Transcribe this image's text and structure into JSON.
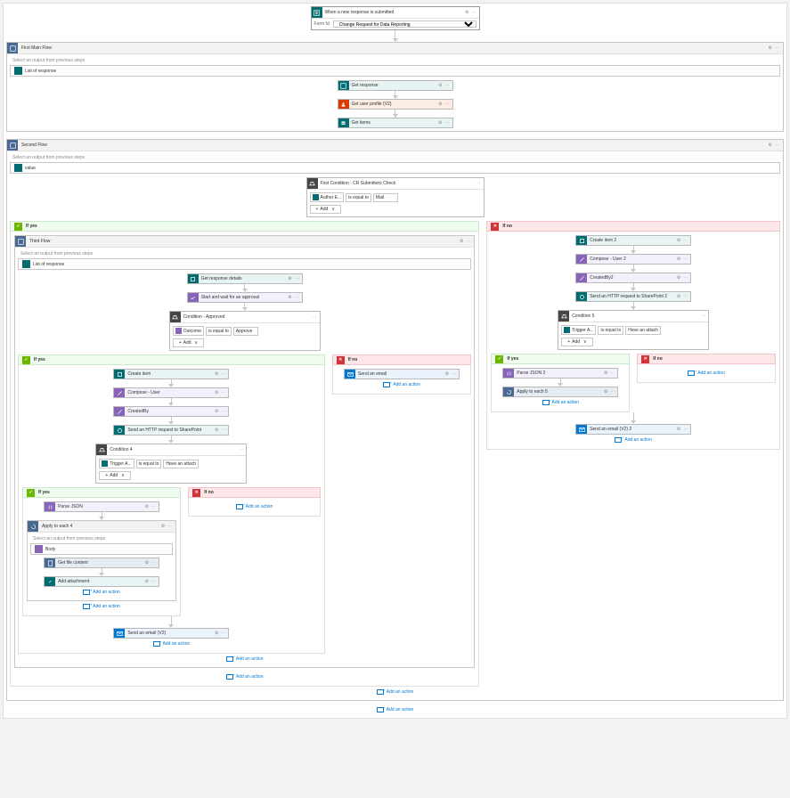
{
  "trigger": {
    "title": "When a new response is submitted",
    "param_label": "Form Id",
    "param_value": "Change Request for Data Reporting"
  },
  "labels": {
    "yes": "If yes",
    "no": "If no",
    "add_action": "Add an action",
    "add": "Add"
  },
  "scope1": {
    "title": "First Main Flow",
    "note": "Select an output from previous steps",
    "token": "List of response",
    "items": [
      "Get response",
      "Get user profile (V2)",
      "Get items"
    ]
  },
  "scope2": {
    "title": "Second Flow",
    "note": "Select an output from previous steps",
    "token": "value"
  },
  "cond1": {
    "title": "First Condition - CR Submitters Check",
    "lhs": "Author E...",
    "op": "is equal to",
    "rhs": "Mail"
  },
  "yes1_scope": {
    "title": "Third Flow",
    "note": "Select an output from previous steps",
    "token": "List of response",
    "items": [
      "Get response details",
      "Start and wait for an approval"
    ]
  },
  "cond2": {
    "title": "Condition - Approved",
    "lhs": "Outcome",
    "op": "is equal to",
    "rhs": "Approve"
  },
  "yes2_items": [
    "Create item",
    "Compose - User",
    "CreatedBy",
    "Send an HTTP request to SharePoint"
  ],
  "cond3": {
    "title": "Condition 4",
    "lhs": "Trigger A...",
    "op": "is equal to",
    "rhs": "Have an attach"
  },
  "yes3_parse": "Parse JSON",
  "yes3_apply": {
    "title": "Apply to each 4",
    "note": "Select an output from previous steps",
    "token": "Body",
    "items": [
      "Get file content",
      "Add attachment"
    ]
  },
  "mail1": "Send an email (V2)",
  "mail_no2": "Send an email",
  "no1_items": [
    "Create item 2",
    "Compose - User 2",
    "CreatedBy2",
    "Send an HTTP request to SharePoint 2"
  ],
  "cond4": {
    "title": "Condition 5",
    "lhs": "Trigger A...",
    "op": "is equal to",
    "rhs": "Have an attach"
  },
  "yes4_parse": "Parse JSON 2",
  "yes4_apply": "Apply to each 5",
  "mail2": "Send an email (V2) 2",
  "cog": "⚙",
  "dots": "⋯",
  "chev": "∨"
}
